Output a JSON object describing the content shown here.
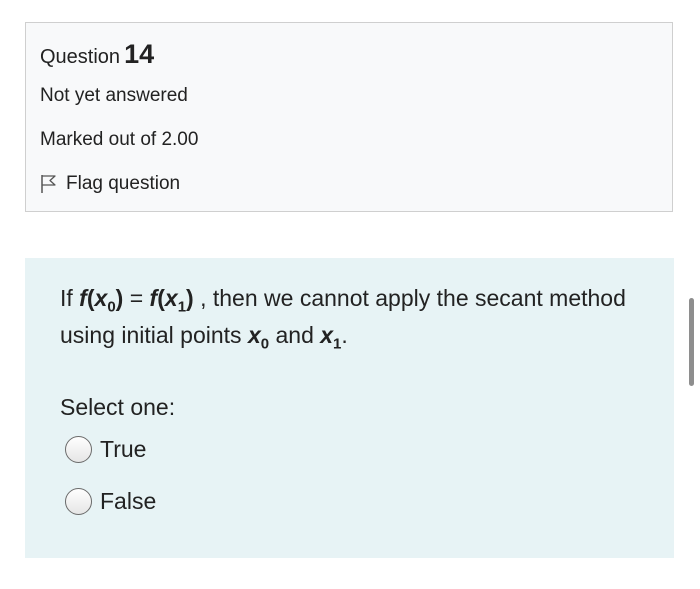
{
  "question": {
    "label": "Question",
    "number": "14",
    "state": "Not yet answered",
    "marked": "Marked out of 2.00",
    "flag_label": "Flag question"
  },
  "content": {
    "text": {
      "if": "If",
      "f_a": "f",
      "x_a": "x",
      "sub0_a": "0",
      "open_a": "(",
      "close_a": ")",
      "equals": "=",
      "f_b": "f",
      "x_b": "x",
      "sub1_b": "1",
      "open_b": "(",
      "close_b": ")",
      "middle": ", then we cannot apply the secant method using initial points",
      "x_c": "x",
      "sub0_c": "0",
      "and": "and",
      "x_d": "x",
      "sub1_d": "1",
      "period": "."
    },
    "prompt": "Select one:",
    "options": [
      {
        "label": "True"
      },
      {
        "label": "False"
      }
    ]
  }
}
